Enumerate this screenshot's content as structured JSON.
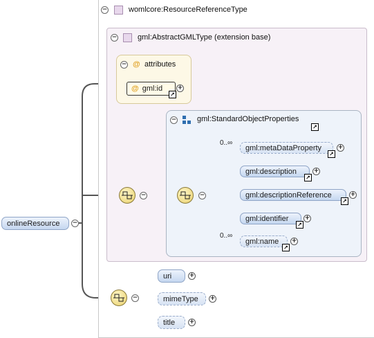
{
  "root": {
    "label": "onlineResource",
    "type_label": "womlcore:ResourceReferenceType"
  },
  "extension": {
    "label": "gml:AbstractGMLType (extension base)"
  },
  "attributes": {
    "label": "attributes",
    "items": [
      {
        "label": "gml:id"
      }
    ]
  },
  "standard_props": {
    "label": "gml:StandardObjectProperties",
    "elements": [
      {
        "label": "gml:metaDataProperty",
        "occurrence": "0..∞"
      },
      {
        "label": "gml:description",
        "occurrence": ""
      },
      {
        "label": "gml:descriptionReference",
        "occurrence": ""
      },
      {
        "label": "gml:identifier",
        "occurrence": ""
      },
      {
        "label": "gml:name",
        "occurrence": "0..∞"
      }
    ]
  },
  "bottom_sequence": {
    "elements": [
      {
        "label": "uri"
      },
      {
        "label": "mimeType"
      },
      {
        "label": "title"
      }
    ]
  },
  "symbols": {
    "collapse": "⊖",
    "expand": "+",
    "link": "↗",
    "at": "@"
  },
  "colors": {
    "element_fill": "#c5d7f0",
    "element_border": "#8ea4c6",
    "attribute_frame": "#fdf8e6",
    "extension_frame": "#f7f1f7",
    "group_frame": "#eef3fa",
    "connector": "#555555"
  }
}
